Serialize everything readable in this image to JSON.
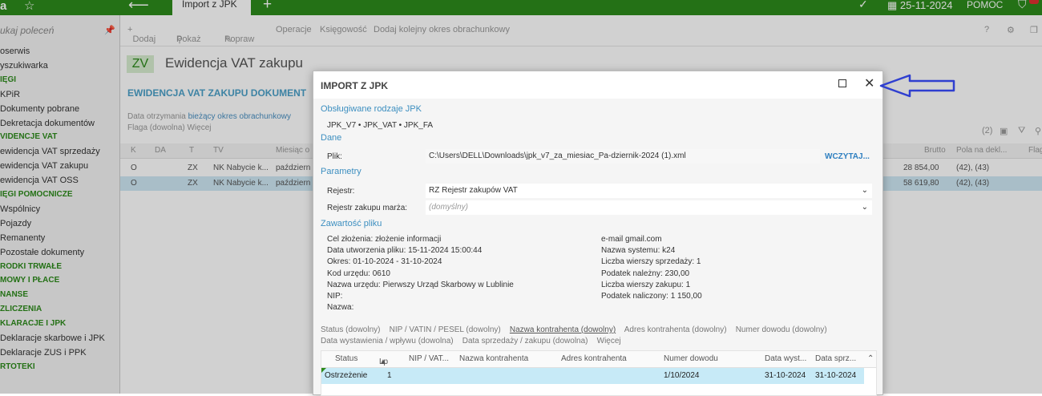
{
  "topbar": {
    "logo": "a",
    "tab_title": "Import z JPK",
    "date": "25-11-2024",
    "help": "POMOC"
  },
  "sidebar": {
    "search_placeholder": "ukaj poleceń",
    "entries": [
      {
        "kind": "item",
        "label": "oserwis"
      },
      {
        "kind": "item",
        "label": "yszukiwarka"
      },
      {
        "kind": "sec",
        "label": "IĘGI"
      },
      {
        "kind": "item",
        "label": "KPiR"
      },
      {
        "kind": "item",
        "label": "Dokumenty pobrane"
      },
      {
        "kind": "item",
        "label": "Dekretacja dokumentów"
      },
      {
        "kind": "sec",
        "label": "VIDENCJE VAT"
      },
      {
        "kind": "item",
        "label": "ewidencja VAT sprzedaży"
      },
      {
        "kind": "item",
        "label": "ewidencja VAT zakupu"
      },
      {
        "kind": "item",
        "label": "ewidencja VAT OSS"
      },
      {
        "kind": "sec",
        "label": "IĘGI POMOCNICZE"
      },
      {
        "kind": "item",
        "label": "Wspólnicy"
      },
      {
        "kind": "item",
        "label": "Pojazdy"
      },
      {
        "kind": "item",
        "label": "Remanenty"
      },
      {
        "kind": "item",
        "label": "Pozostałe dokumenty"
      },
      {
        "kind": "sec",
        "label": "RODKI TRWAŁE"
      },
      {
        "kind": "sec",
        "label": "MOWY I PŁACE"
      },
      {
        "kind": "sec",
        "label": "NANSE"
      },
      {
        "kind": "sec",
        "label": "ZLICZENIA"
      },
      {
        "kind": "sec",
        "label": "KLARACJE I JPK"
      },
      {
        "kind": "item",
        "label": "Deklaracje skarbowe i JPK"
      },
      {
        "kind": "item",
        "label": "Deklaracje ZUS i PPK"
      },
      {
        "kind": "sec",
        "label": "RTOTEKI"
      }
    ]
  },
  "toolbar": {
    "add": "Dodaj",
    "show": "Pokaż",
    "fix": "Popraw",
    "operations": "Operacje",
    "accounting": "Księgowość",
    "add_period": "Dodaj kolejny okres obrachunkowy"
  },
  "main": {
    "zv": "ZV",
    "title": "Ewidencja VAT zakupu",
    "subhead": "EWIDENCJA VAT ZAKUPU DOKUMENT",
    "filter_line1_a": "Data otrzymania",
    "filter_line1_b": "bieżący okres obrachunkowy",
    "filter_line2": "Flaga (dowolna)   Więcej",
    "count": "(2)",
    "columns": [
      "K",
      "DA",
      "T",
      "TV",
      "Miesiąc o",
      "Brutto",
      "Pola na dekl...",
      "Flag"
    ],
    "rows": [
      {
        "k": "O",
        "t": "ZX",
        "tv": "NK Nabycie k...",
        "month": "październ",
        "brutto": "28 854,00",
        "pola": "(42), (43)"
      },
      {
        "k": "O",
        "t": "ZX",
        "tv": "NK Nabycie k...",
        "month": "październ",
        "brutto": "58 619,80",
        "pola": "(42), (43)"
      }
    ]
  },
  "dialog": {
    "title": "IMPORT Z JPK",
    "sec_types": "Obsługiwane rodzaje JPK",
    "types": "JPK_V7 • JPK_VAT • JPK_FA",
    "sec_data": "Dane",
    "file_label": "Plik:",
    "file_value": "C:\\Users\\DELL\\Downloads\\jpk_v7_za_miesiac_Pa-dziernik-2024 (1).xml",
    "load_button": "WCZYTAJ...",
    "sec_params": "Parametry",
    "register_label": "Rejestr:",
    "register_value": "RZ  Rejestr zakupów VAT",
    "margin_label": "Rejestr zakupu marża:",
    "margin_value": "(domyślny)",
    "sec_content": "Zawartość pliku",
    "left_info": [
      "Cel złożenia: złożenie informacji",
      "Data utworzenia pliku: 15-11-2024 15:00:44",
      "Okres: 01-10-2024 - 31-10-2024",
      "Kod urzędu: 0610",
      "Nazwa urzędu: Pierwszy Urząd Skarbowy w Lublinie",
      "NIP:",
      "Nazwa:"
    ],
    "right_info": [
      "e-mail             gmail.com",
      "Nazwa systemu: k24",
      "Liczba wierszy sprzedaży: 1",
      "Podatek należny: 230,00",
      "Liczba wierszy zakupu: 1",
      "Podatek naliczony: 1 150,00"
    ],
    "filters1": [
      "Status (dowolny)",
      "NIP / VATIN / PESEL (dowolny)",
      "Nazwa kontrahenta (dowolny)",
      "Adres kontrahenta (dowolny)",
      "Numer dowodu (dowolny)"
    ],
    "filters2": [
      "Data wystawienia / wpływu (dowolna)",
      "Data sprzedaży / zakupu (dowolna)",
      "Więcej"
    ],
    "grid_columns": [
      "Status",
      "Lp",
      "NIP / VAT...",
      "Nazwa kontrahenta",
      "Adres kontrahenta",
      "Numer dowodu",
      "Data wyst...",
      "Data sprz..."
    ],
    "grid_row": {
      "status": "Ostrzeżenie",
      "lp": "1",
      "number": "1/10/2024",
      "issue": "31-10-2024",
      "sale": "31-10-2024"
    }
  },
  "colors": {
    "brand_green": "#2d8a1b",
    "accent_blue": "#2e7fc0",
    "selected_row": "#c7eaf7",
    "annotation_arrow": "#2f3fd0"
  }
}
